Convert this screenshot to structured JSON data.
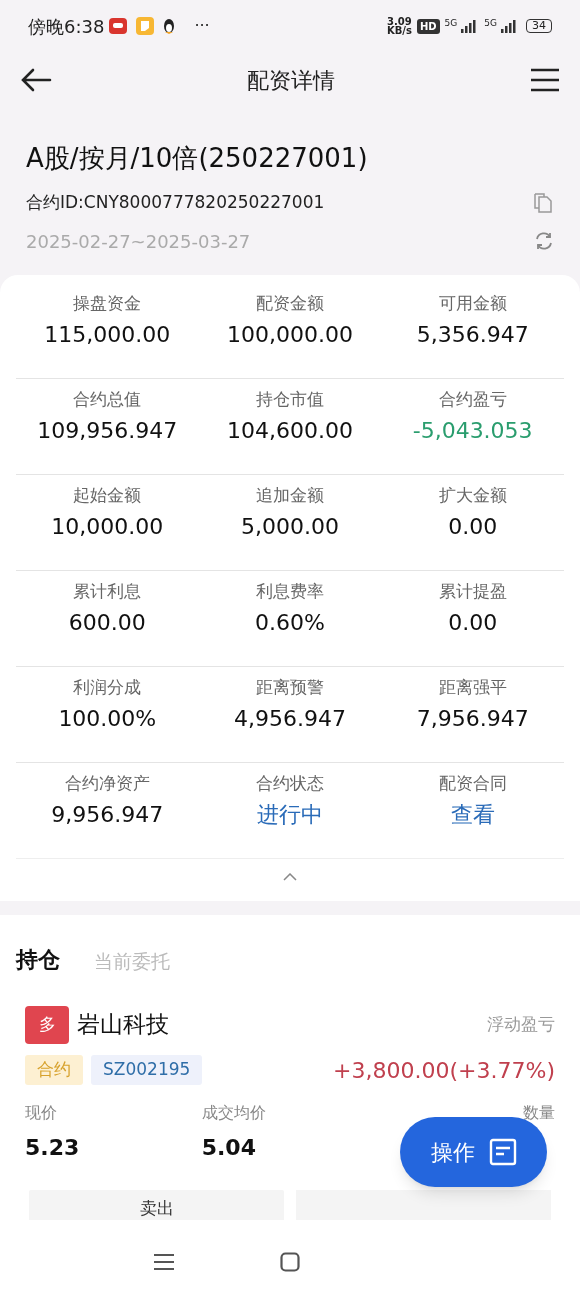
{
  "status_bar": {
    "time": "傍晚6:38",
    "more": "···",
    "speed": "3.09",
    "speed_unit": "KB/s",
    "hd": "HD",
    "network_1": "5G",
    "network_2": "5G",
    "battery": "34"
  },
  "header": {
    "title": "配资详情"
  },
  "contract": {
    "title": "A股/按月/10倍(250227001)",
    "id": "合约ID:CNY8000777820250227001",
    "period": "2025-02-27~2025-03-27"
  },
  "stats": [
    {
      "label": "操盘资金",
      "value": "115,000.00",
      "kind": "plain"
    },
    {
      "label": "配资金额",
      "value": "100,000.00",
      "kind": "plain"
    },
    {
      "label": "可用金额",
      "value": "5,356.947",
      "kind": "plain"
    },
    {
      "label": "合约总值",
      "value": "109,956.947",
      "kind": "plain"
    },
    {
      "label": "持仓市值",
      "value": "104,600.00",
      "kind": "plain"
    },
    {
      "label": "合约盈亏",
      "value": "-5,043.053",
      "kind": "loss"
    },
    {
      "label": "起始金额",
      "value": "10,000.00",
      "kind": "plain"
    },
    {
      "label": "追加金额",
      "value": "5,000.00",
      "kind": "plain"
    },
    {
      "label": "扩大金额",
      "value": "0.00",
      "kind": "plain"
    },
    {
      "label": "累计利息",
      "value": "600.00",
      "kind": "plain"
    },
    {
      "label": "利息费率",
      "value": "0.60%",
      "kind": "plain"
    },
    {
      "label": "累计提盈",
      "value": "0.00",
      "kind": "plain"
    },
    {
      "label": "利润分成",
      "value": "100.00%",
      "kind": "plain"
    },
    {
      "label": "距离预警",
      "value": "4,956.947",
      "kind": "plain"
    },
    {
      "label": "距离强平",
      "value": "7,956.947",
      "kind": "plain"
    },
    {
      "label": "合约净资产",
      "value": "9,956.947",
      "kind": "plain"
    },
    {
      "label": "合约状态",
      "value": "进行中",
      "kind": "link"
    },
    {
      "label": "配资合同",
      "value": "查看",
      "kind": "link"
    }
  ],
  "tabs": [
    {
      "label": "持仓",
      "selected": true
    },
    {
      "label": "当前委托",
      "selected": false
    }
  ],
  "position": {
    "direction": "多",
    "name": "岩山科技",
    "pnl_label": "浮动盈亏",
    "tags": [
      "合约",
      "SZ002195"
    ],
    "pnl": "+3,800.00(+3.77%)",
    "fields": [
      {
        "label": "现价",
        "value": "5.23"
      },
      {
        "label": "成交均价",
        "value": "5.04"
      },
      {
        "label": "数量"
      }
    ],
    "buttons": [
      "卖出"
    ]
  },
  "fab": {
    "label": "操作"
  }
}
